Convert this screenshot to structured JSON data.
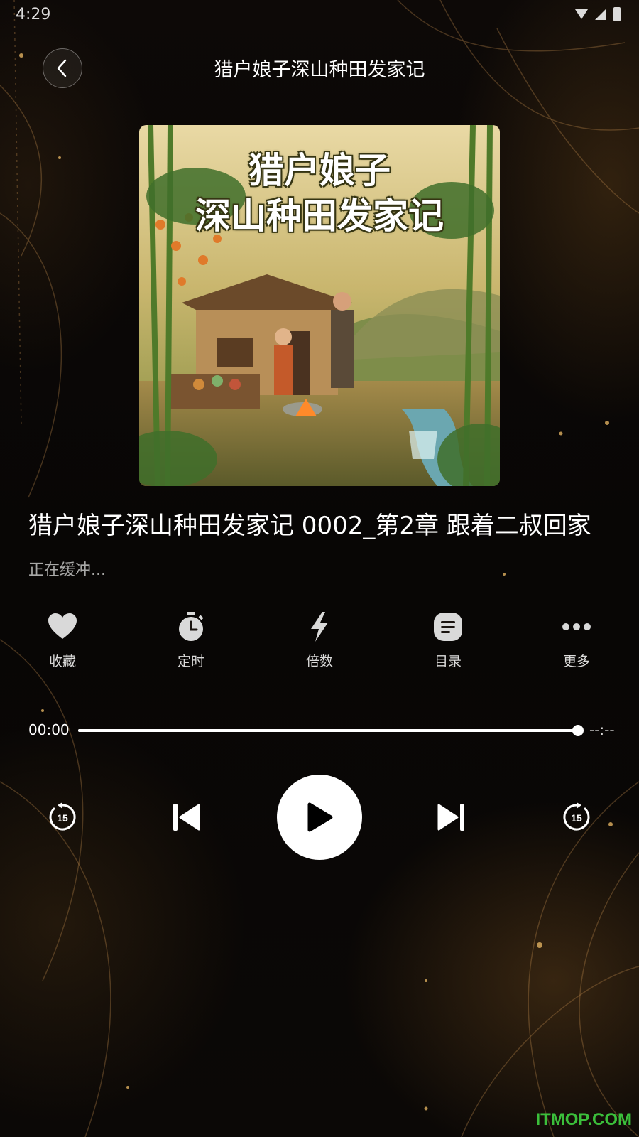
{
  "status_bar": {
    "time": "4:29"
  },
  "header": {
    "title": "猎户娘子深山种田发家记"
  },
  "cover": {
    "title_line1": "猎户娘子",
    "title_line2": "深山种田发家记"
  },
  "track": {
    "title": "猎户娘子深山种田发家记 0002_第2章 跟着二叔回家",
    "status": "正在缓冲..."
  },
  "actions": [
    {
      "label": "收藏",
      "icon": "heart-icon"
    },
    {
      "label": "定时",
      "icon": "timer-icon"
    },
    {
      "label": "倍数",
      "icon": "lightning-icon"
    },
    {
      "label": "目录",
      "icon": "list-icon"
    },
    {
      "label": "更多",
      "icon": "more-dots-icon"
    }
  ],
  "progress": {
    "current": "00:00",
    "total": "--:--",
    "fraction": 1.0
  },
  "controls": {
    "rewind_seconds": "15",
    "forward_seconds": "15"
  },
  "watermark": "ITMOP.COM",
  "colors": {
    "background": "#0b0806",
    "accent_gold": "#c8954a",
    "watermark": "#3bbf3b"
  }
}
